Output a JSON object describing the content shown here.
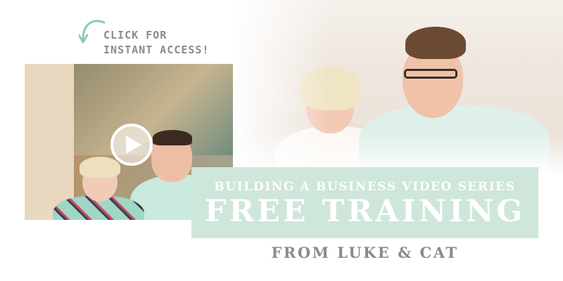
{
  "callout": {
    "line1": "CLICK FOR",
    "line2": "INSTANT ACCESS!",
    "arrow_icon": "curved-arrow-icon",
    "arrow_color": "#8cc9b2"
  },
  "video": {
    "play_icon": "play-icon"
  },
  "banner": {
    "subtitle": "BUILDING A BUSINESS VIDEO SERIES",
    "title": "FREE TRAINING",
    "background_color": "#cfe6db"
  },
  "byline": "FROM LUKE & CAT",
  "colors": {
    "text_gray": "#8a8a8a",
    "white": "#ffffff",
    "mint": "#cfe6db"
  }
}
